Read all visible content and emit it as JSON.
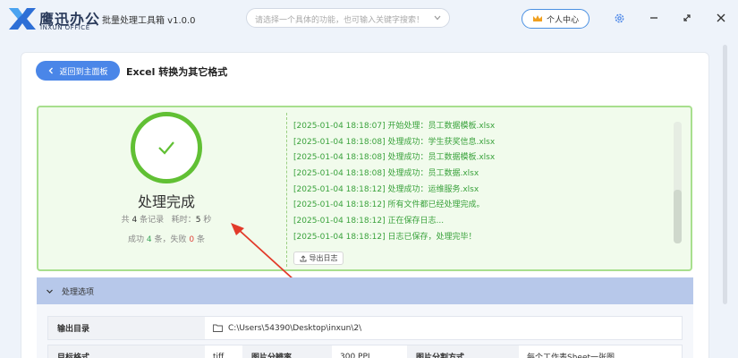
{
  "header": {
    "brand": "鹰迅办公",
    "brand_sub": "INXUN OFFICE",
    "app_name": "批量处理工具箱 v1.0.0",
    "search_placeholder": "请选择一个具体的功能，也可输入关键字搜索！",
    "user_center": "个人中心"
  },
  "nav": {
    "back": "返回到主面板",
    "title": "Excel 转换为其它格式"
  },
  "result": {
    "status": "处理完成",
    "total_prefix": "共",
    "total": "4",
    "total_suffix": "条记录",
    "time_prefix": "耗时：",
    "time": "5",
    "time_suffix": "秒",
    "success_prefix": "成功",
    "success": "4",
    "success_suffix": "条，失败",
    "fail": "0",
    "fail_suffix": "条",
    "log": [
      "[2025-01-04 18:18:07] 开始处理：员工数据模板.xlsx",
      "[2025-01-04 18:18:08] 处理成功：学生获奖信息.xlsx",
      "[2025-01-04 18:18:08] 处理成功：员工数据模板.xlsx",
      "[2025-01-04 18:18:08] 处理成功：员工数据.xlsx",
      "[2025-01-04 18:18:12] 处理成功：运维服务.xlsx",
      "[2025-01-04 18:18:12] 所有文件都已经处理完成。",
      "[2025-01-04 18:18:12] 正在保存日志...",
      "[2025-01-04 18:18:12] 日志已保存，处理完毕！"
    ],
    "export_log": "导出日志"
  },
  "options": {
    "title": "处理选项",
    "output_dir_label": "输出目录",
    "output_dir_value": "C:\\Users\\54390\\Desktop\\inxun\\2\\",
    "target_format_label": "目标格式",
    "target_format_value": "tiff",
    "resolution_label": "图片分辨率",
    "resolution_value": "300 PPI",
    "split_label": "图片分割方式",
    "split_value": "每个工作表Sheet一张图"
  },
  "colors": {
    "accent": "#4a86e8",
    "success": "#61c034",
    "log_text": "#3aa23c",
    "panel_bg": "#f1fbec",
    "fail": "#e0453a"
  }
}
